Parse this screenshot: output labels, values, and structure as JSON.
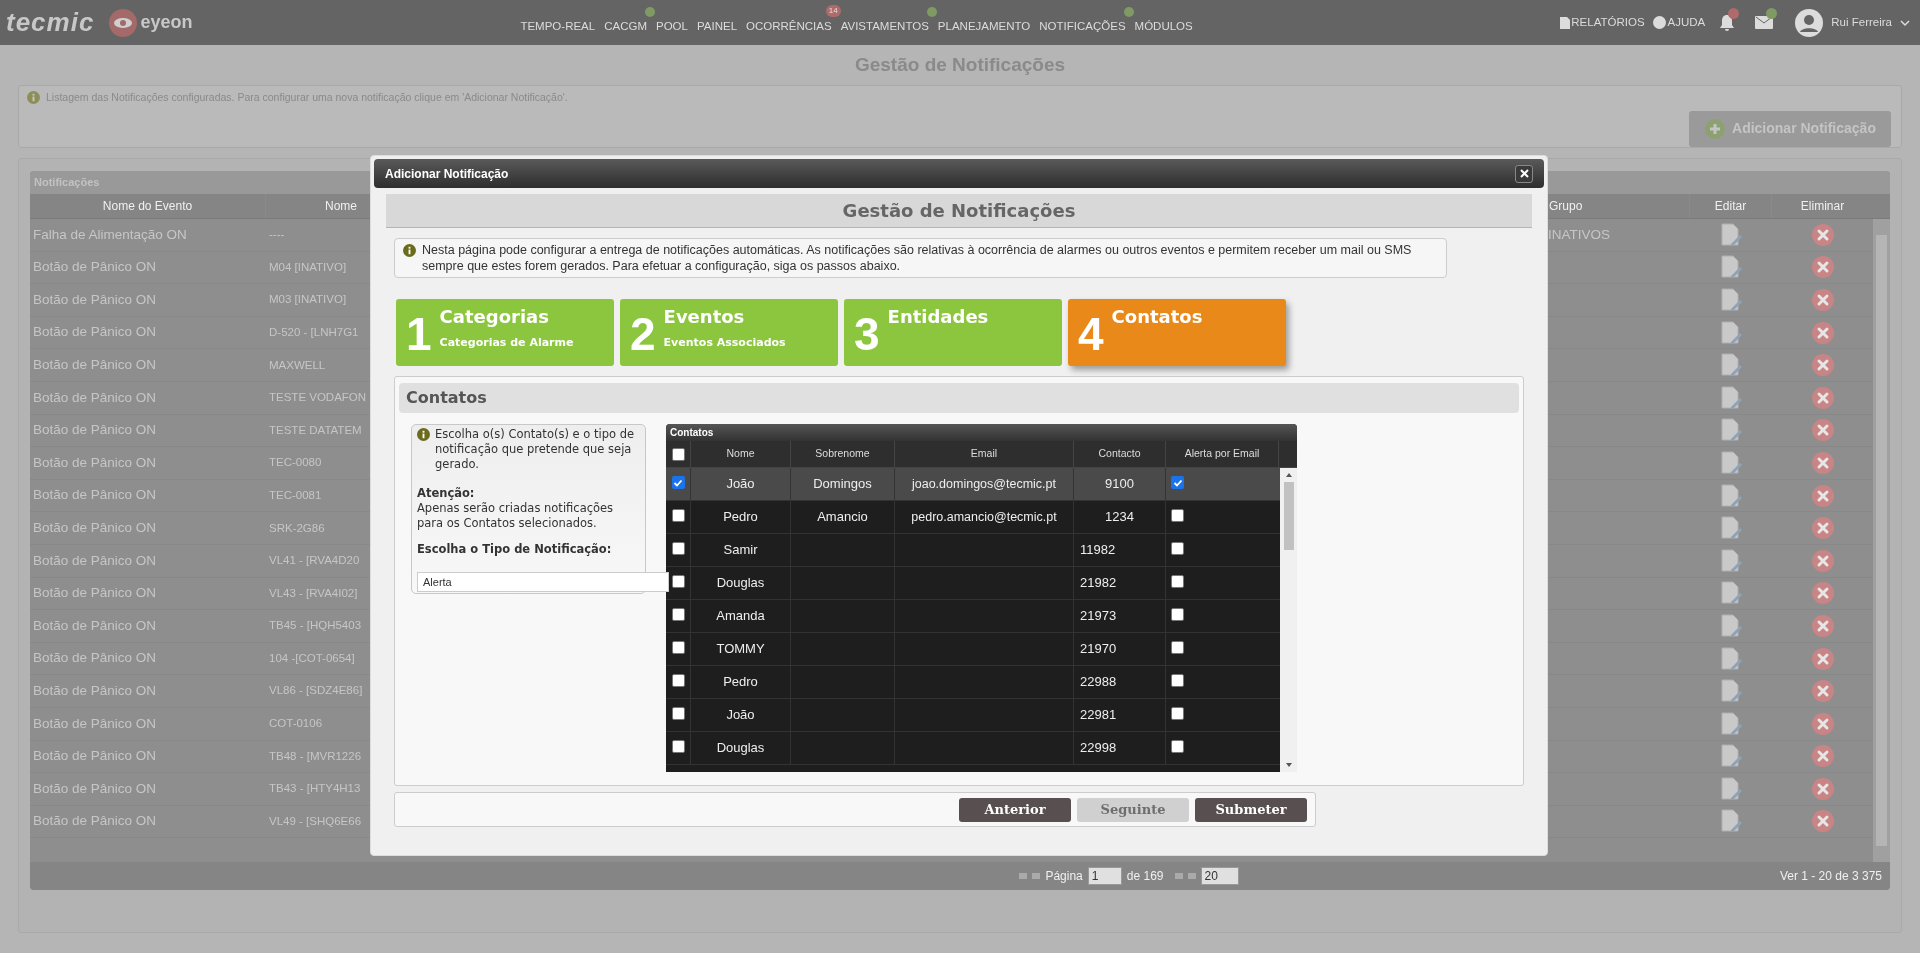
{
  "header": {
    "logo": "tecmic",
    "product": "eyeon",
    "nav": [
      {
        "label": "TEMPO-REAL",
        "notified": false
      },
      {
        "label": "CACGM",
        "notified": true
      },
      {
        "label": "POOL",
        "notified": false
      },
      {
        "label": "PAINEL",
        "notified": false
      },
      {
        "label": "OCORRÊNCIAS",
        "badge": "14",
        "notified": true
      },
      {
        "label": "AVISTAMENTOS",
        "notified": true
      },
      {
        "label": "PLANEJAMENTO",
        "notified": false
      },
      {
        "label": "NOTIFICAÇÕES",
        "notified": true
      },
      {
        "label": "MÓDULOS",
        "notified": false
      }
    ],
    "reports": "RELATÓRIOS",
    "help": "AJUDA",
    "alerts_notified": true,
    "messages_notified": true,
    "user": "Rui Ferreira"
  },
  "page": {
    "title": "Gestão de Notificações",
    "info": "Listagem das Notificações configuradas. Para configurar uma nova notificação clique em 'Adicionar Notificação'.",
    "add_button": "Adicionar Notificação"
  },
  "grid": {
    "title": "Notificações",
    "columns": [
      "Nome do Evento",
      "Nome",
      "Grupo",
      "Editar",
      "Eliminar"
    ],
    "rows": [
      {
        "event": "Falha de Alimentação ON",
        "name": "----",
        "group": "INATIVOS"
      },
      {
        "event": "Botão de Pânico ON",
        "name": "M04  [INATIVO]"
      },
      {
        "event": "Botão de Pânico ON",
        "name": "M03 [INATIVO]"
      },
      {
        "event": "Botão de Pânico ON",
        "name": "D-520 - [LNH7G1"
      },
      {
        "event": "Botão de Pânico ON",
        "name": "MAXWELL"
      },
      {
        "event": "Botão de Pânico ON",
        "name": "TESTE VODAFON"
      },
      {
        "event": "Botão de Pânico ON",
        "name": "TESTE DATATEM"
      },
      {
        "event": "Botão de Pânico ON",
        "name": "TEC-0080"
      },
      {
        "event": "Botão de Pânico ON",
        "name": "TEC-0081"
      },
      {
        "event": "Botão de Pânico ON",
        "name": "SRK-2G86"
      },
      {
        "event": "Botão de Pânico ON",
        "name": "VL41 - [RVA4D20"
      },
      {
        "event": "Botão de Pânico ON",
        "name": "VL43 - [RVA4I02]"
      },
      {
        "event": "Botão de Pânico ON",
        "name": "TB45 - [HQH5403"
      },
      {
        "event": "Botão de Pânico ON",
        "name": "104 -[COT-0654]"
      },
      {
        "event": "Botão de Pânico ON",
        "name": "VL86 - [SDZ4E86]"
      },
      {
        "event": "Botão de Pânico ON",
        "name": "COT-0106"
      },
      {
        "event": "Botão de Pânico ON",
        "name": "TB48 - [MVR1226"
      },
      {
        "event": "Botão de Pânico ON",
        "name": "TB43 - [HTY4H13"
      },
      {
        "event": "Botão de Pânico ON",
        "name": "VL49 - [SHQ6E66"
      }
    ],
    "pager": {
      "page_label": "Página",
      "page": "1",
      "of": "de 169",
      "page_size": "20",
      "summary": "Ver 1 - 20 de 3 375"
    }
  },
  "dialog": {
    "title": "Adicionar Notificação",
    "heading": "Gestão de Notificações",
    "intro": "Nesta página pode configurar a entrega de notificações automáticas. As notificações são relativas à ocorrência de alarmes ou outros eventos e permitem receber um mail ou SMS sempre que estes forem gerados. Para efetuar a configuração, siga os passos abaixo.",
    "steps": [
      {
        "number": "1",
        "title": "Categorias",
        "subtitle": "Categorias de Alarme",
        "selected": false
      },
      {
        "number": "2",
        "title": "Eventos",
        "subtitle": "Eventos Associados",
        "selected": false
      },
      {
        "number": "3",
        "title": "Entidades",
        "selected": false
      },
      {
        "number": "4",
        "title": "Contatos",
        "selected": true
      }
    ],
    "section": {
      "title": "Contatos",
      "help": "Escolha o(s) Contato(s) e o tipo de notificação que pretende que seja gerado.",
      "warning_title": "Atenção:",
      "warning": "Apenas serão criadas notificações para os Contatos selecionados.",
      "type_label": "Escolha o Tipo de Notificação:",
      "type_value": "Alerta"
    },
    "contacts": {
      "title": "Contatos",
      "all_checked": false,
      "columns": [
        "Nome",
        "Sobrenome",
        "Email",
        "Contacto",
        "Alerta por Email"
      ],
      "rows": [
        {
          "name": "João",
          "surname": "Domingos",
          "email": "joao.domingos@tecmic.pt",
          "contact": "9100",
          "checked": true,
          "email_alert": true
        },
        {
          "name": "Pedro",
          "surname": "Amancio",
          "email": "pedro.amancio@tecmic.pt",
          "contact": "1234",
          "checked": false,
          "email_alert": false
        },
        {
          "name": "Samir",
          "contact": "11982",
          "checked": false,
          "email_alert": false
        },
        {
          "name": "Douglas",
          "contact": "21982",
          "checked": false,
          "email_alert": false
        },
        {
          "name": "Amanda",
          "contact": "21973",
          "checked": false,
          "email_alert": false
        },
        {
          "name": "TOMMY",
          "contact": "21970",
          "checked": false,
          "email_alert": false
        },
        {
          "name": "Pedro",
          "contact": "22988",
          "checked": false,
          "email_alert": false
        },
        {
          "name": "João",
          "contact": "22981",
          "checked": false,
          "email_alert": false
        },
        {
          "name": "Douglas",
          "contact": "22998",
          "checked": false,
          "email_alert": false
        }
      ]
    },
    "buttons": [
      {
        "label": "Anterior",
        "disabled": false
      },
      {
        "label": "Seguinte",
        "disabled": true
      },
      {
        "label": "Submeter",
        "disabled": false
      }
    ]
  }
}
